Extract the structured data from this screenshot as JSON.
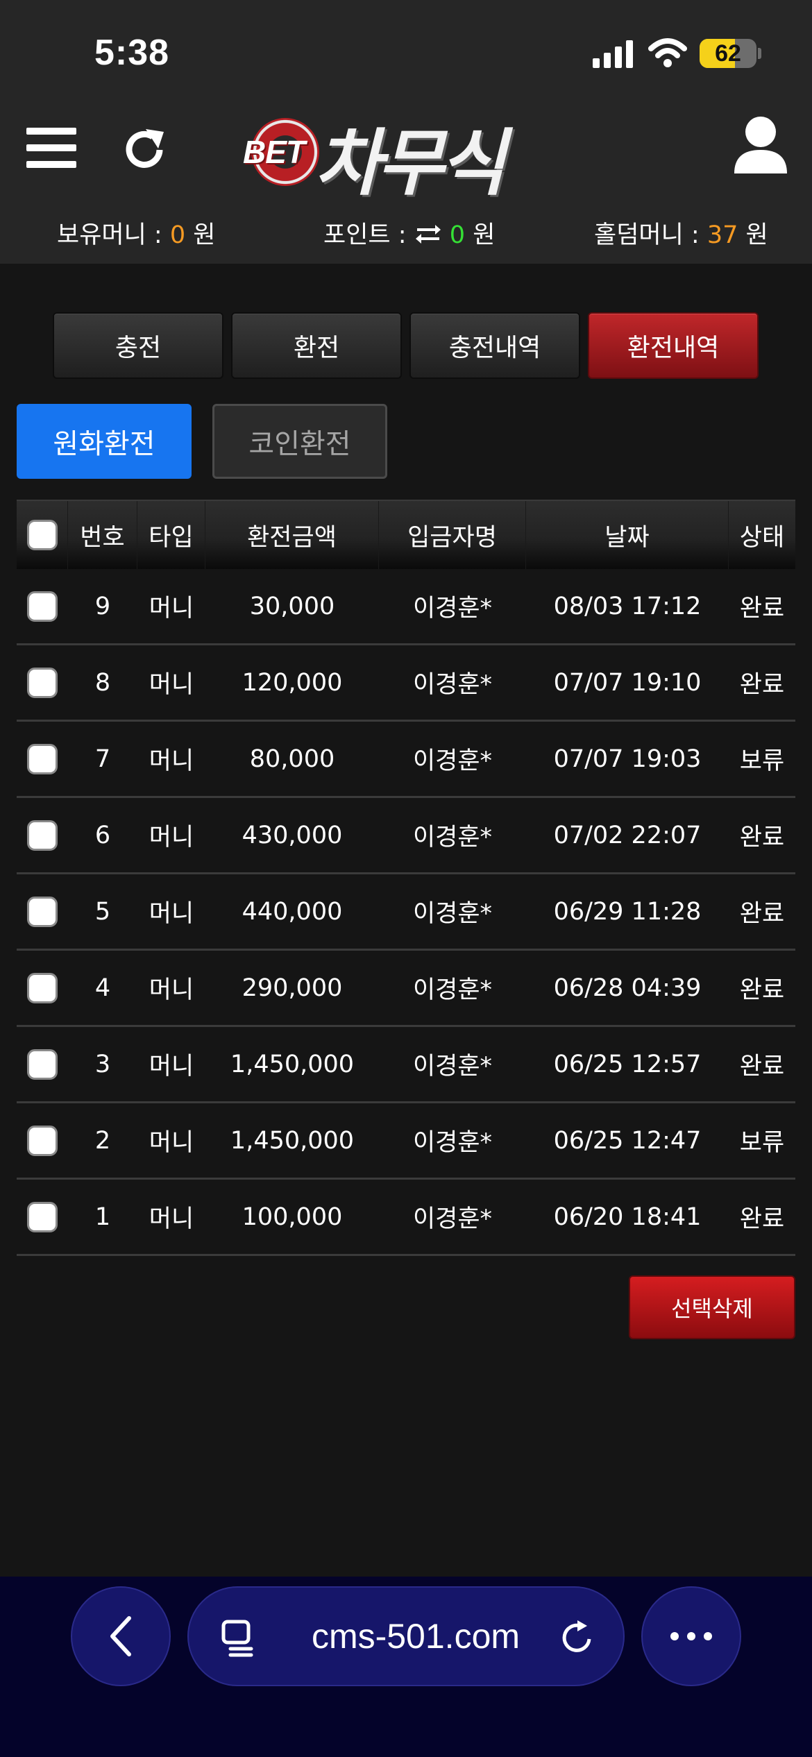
{
  "status_bar": {
    "time": "5:38",
    "battery_level": 62,
    "battery_text": "62",
    "icons": [
      "signal-icon",
      "wifi-icon",
      "battery-icon"
    ]
  },
  "header": {
    "logo": {
      "prefix": "BET",
      "name": "차무식"
    },
    "icons": [
      "menu-icon",
      "refresh-icon",
      "user-icon"
    ],
    "balances": {
      "money_label": "보유머니 : ",
      "money_value": "0",
      "money_unit": " 원",
      "point_label": "포인트 : ",
      "point_value": "0",
      "point_unit": " 원",
      "hold_label": "홀덤머니 : ",
      "hold_value": "37",
      "hold_unit": " 원"
    }
  },
  "tabs": [
    {
      "label": "충전",
      "active": false
    },
    {
      "label": "환전",
      "active": false
    },
    {
      "label": "충전내역",
      "active": false
    },
    {
      "label": "환전내역",
      "active": true
    }
  ],
  "sub_tabs": [
    {
      "label": "원화환전",
      "active": true
    },
    {
      "label": "코인환전",
      "active": false
    }
  ],
  "table": {
    "headers": [
      "번호",
      "타입",
      "환전금액",
      "입금자명",
      "날짜",
      "상태"
    ],
    "rows": [
      {
        "num": "9",
        "type": "머니",
        "amount": "30,000",
        "name": "이경훈*",
        "date": "08/03 17:12",
        "status": "완료"
      },
      {
        "num": "8",
        "type": "머니",
        "amount": "120,000",
        "name": "이경훈*",
        "date": "07/07 19:10",
        "status": "완료"
      },
      {
        "num": "7",
        "type": "머니",
        "amount": "80,000",
        "name": "이경훈*",
        "date": "07/07 19:03",
        "status": "보류"
      },
      {
        "num": "6",
        "type": "머니",
        "amount": "430,000",
        "name": "이경훈*",
        "date": "07/02 22:07",
        "status": "완료"
      },
      {
        "num": "5",
        "type": "머니",
        "amount": "440,000",
        "name": "이경훈*",
        "date": "06/29 11:28",
        "status": "완료"
      },
      {
        "num": "4",
        "type": "머니",
        "amount": "290,000",
        "name": "이경훈*",
        "date": "06/28 04:39",
        "status": "완료"
      },
      {
        "num": "3",
        "type": "머니",
        "amount": "1,450,000",
        "name": "이경훈*",
        "date": "06/25 12:57",
        "status": "완료"
      },
      {
        "num": "2",
        "type": "머니",
        "amount": "1,450,000",
        "name": "이경훈*",
        "date": "06/25 12:47",
        "status": "보류"
      },
      {
        "num": "1",
        "type": "머니",
        "amount": "100,000",
        "name": "이경훈*",
        "date": "06/20 18:41",
        "status": "완료"
      }
    ]
  },
  "actions": {
    "delete_label": "선택삭제"
  },
  "browser": {
    "url": "cms-501.com",
    "icons": [
      "back-icon",
      "tabs-icon",
      "reload-icon",
      "more-icon"
    ]
  },
  "colors": {
    "background": "#151515",
    "header": "#262626",
    "active_tab": "#b11c20",
    "active_sub_tab": "#1775f0",
    "accent_orange": "#f59a23",
    "accent_green": "#35e035",
    "browser_bar": "#04032a"
  }
}
